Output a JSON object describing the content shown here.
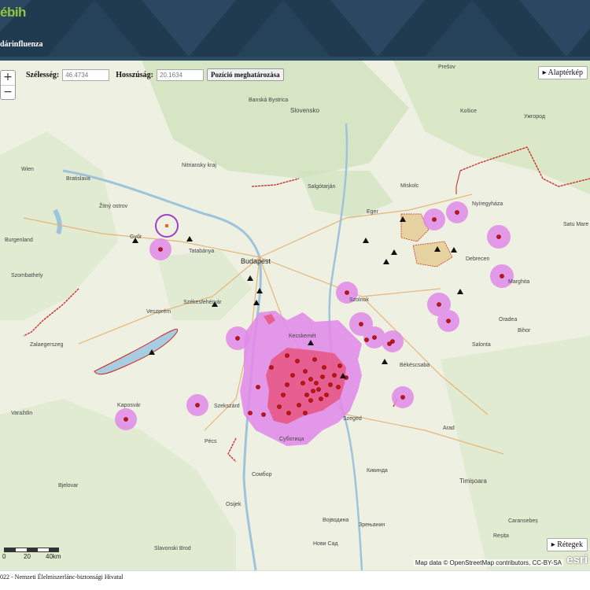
{
  "header": {
    "logo_text": "ébih",
    "title": "dárinfluenza",
    "bg_color": "#203a50",
    "logo_color": "#8ec63f"
  },
  "map_controls": {
    "zoom_in": "+",
    "zoom_out": "−",
    "latitude_label": "Szélesség:",
    "latitude_value": "46.4734",
    "longitude_label": "Hosszúság:",
    "longitude_value": "20.1634",
    "locate_button": "Pozíció meghatározása",
    "basemap_button": "▸ Alaptérkép",
    "layers_button": "▸ Rétegek"
  },
  "scale_bar": {
    "labels": [
      "0",
      "20",
      "40km"
    ]
  },
  "attribution": {
    "text": "Map data © OpenStreetMap contributors, CC-BY-SA",
    "esri": "esri"
  },
  "footer": {
    "text": "022 - Nemzeti Élelmiszerlánc-biztonsági Hivatal"
  },
  "map_labels": {
    "presov": "Prešov",
    "kosice": "Košice",
    "banska": "Banská Bystrica",
    "slovensko": "Slovensko",
    "uzhorod": "Ужгород",
    "bratislava": "Bratislava",
    "nitriansky": "Nitriansky kraj",
    "wien": "Wien",
    "zitny": "Žitný ostrov",
    "salgotarjan": "Salgótarján",
    "miskolc": "Miskolc",
    "nyiregyhaza": "Nyíregyháza",
    "eger": "Eger",
    "gyor": "Győr",
    "tatabanya": "Tatabánya",
    "budapest": "Budapest",
    "debrecen": "Debrecen",
    "satu_mare": "Satu Mare",
    "szombathely": "Szombathely",
    "szekesfehervar": "Székesfehérvár",
    "szolnok": "Szolnok",
    "veszprem": "Veszprém",
    "oradea": "Oradea",
    "zalaegerszeg": "Zalaegerszeg",
    "kecskemet": "Kecskemét",
    "bekescsaba": "Békéscsaba",
    "kaposvar": "Kaposvár",
    "szekszard": "Szekszárd",
    "szeged": "Szeged",
    "arad": "Arad",
    "pecs": "Pécs",
    "subotica": "Суботица",
    "sombor": "Сомбор",
    "timisoara": "Timișoara",
    "osijek": "Osijek",
    "novi_sad": "Нови Сад",
    "zrenjanin": "Зрењанин",
    "burgenland": "Burgenland",
    "marghita": "Marghita",
    "bihor": "Bihor",
    "vojvodina": "Војводина",
    "kikinda": "Кикинда",
    "slavonski": "Slavonski Brod",
    "bjelovar": "Bjelovar",
    "caransebes": "Caransebeș",
    "resita": "Reșița",
    "salonta": "Salonta",
    "varazdin": "Varaždin"
  },
  "colors": {
    "protection_zone": "#e08ae8",
    "surveillance_zone": "#e8507a",
    "outbreak_point": "#cc1111",
    "monitoring_marker": "#111111",
    "border": "#cc2222",
    "water": "#a8cce0"
  }
}
